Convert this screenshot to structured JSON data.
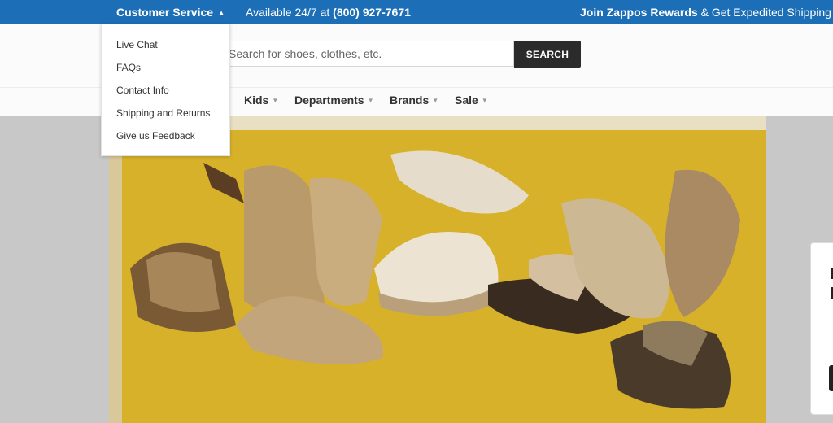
{
  "topbar": {
    "customer_service": "Customer Service",
    "availability_prefix": "Available 24/7 at",
    "phone": "(800) 927-7671",
    "rewards_bold": "Join Zappos Rewards",
    "rewards_rest": "& Get Expedited Shipping + Ear"
  },
  "dropdown": {
    "items": [
      {
        "label": "Live Chat"
      },
      {
        "label": "FAQs"
      },
      {
        "label": "Contact Info"
      },
      {
        "label": "Shipping and Returns"
      },
      {
        "label": "Give us Feedback"
      }
    ]
  },
  "search": {
    "placeholder": "Search for shoes, clothes, etc.",
    "button_label": "SEARCH"
  },
  "nav": {
    "items": [
      {
        "label": "Kids"
      },
      {
        "label": "Departments"
      },
      {
        "label": "Brands"
      },
      {
        "label": "Sale"
      }
    ]
  },
  "colors": {
    "topbar": "#1c6fb7",
    "hero": "#d8b12a",
    "search_button": "#2b2b2b"
  },
  "icons": {
    "caret": "caret-up-icon",
    "chevron": "chevron-down-icon"
  }
}
